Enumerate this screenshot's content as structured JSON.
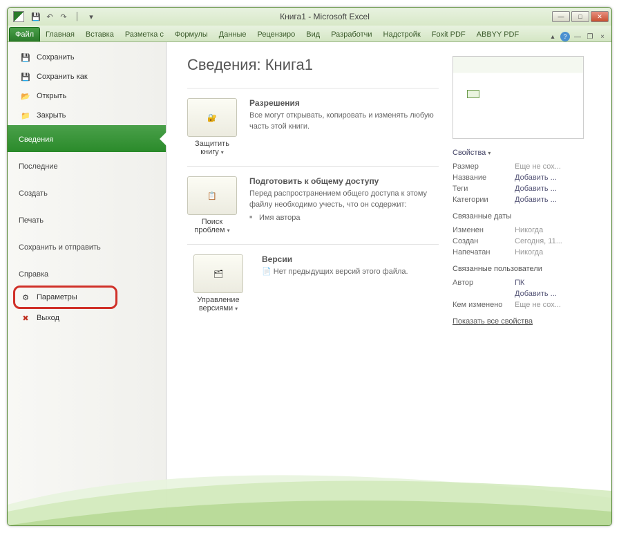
{
  "title": "Книга1  -  Microsoft Excel",
  "qat": {
    "save": "💾",
    "undo": "↶",
    "redo": "↷",
    "sep": "│",
    "more": "▾"
  },
  "win": {
    "min": "—",
    "max": "□",
    "close": "✕"
  },
  "tabs": [
    "Файл",
    "Главная",
    "Вставка",
    "Разметка с",
    "Формулы",
    "Данные",
    "Рецензиро",
    "Вид",
    "Разработчи",
    "Надстройк",
    "Foxit PDF",
    "ABBYY PDF"
  ],
  "ribbon_right": {
    "help": "?",
    "up": "▴",
    "min2": "—",
    "restore": "❐",
    "close2": "×"
  },
  "side": {
    "save": "Сохранить",
    "save_as": "Сохранить как",
    "open": "Открыть",
    "close": "Закрыть",
    "info": "Сведения",
    "recent": "Последние",
    "new": "Создать",
    "print": "Печать",
    "share": "Сохранить и отправить",
    "help": "Справка",
    "options": "Параметры",
    "exit": "Выход"
  },
  "page": {
    "heading": "Сведения: Книга1",
    "perm": {
      "btn": "Защитить книгу",
      "title": "Разрешения",
      "text": "Все могут открывать, копировать и изменять любую часть этой книги."
    },
    "prep": {
      "btn": "Поиск проблем",
      "title": "Подготовить к общему доступу",
      "text": "Перед распространением общего доступа к этому файлу необходимо учесть, что он содержит:",
      "item1": "Имя автора"
    },
    "vers": {
      "btn": "Управление версиями",
      "title": "Версии",
      "text": "Нет предыдущих версий этого файла."
    }
  },
  "props": {
    "title": "Свойства",
    "rows1": [
      {
        "k": "Размер",
        "v": "Еще не сох..."
      },
      {
        "k": "Название",
        "v": "Добавить ..."
      },
      {
        "k": "Теги",
        "v": "Добавить ..."
      },
      {
        "k": "Категории",
        "v": "Добавить ..."
      }
    ],
    "dates_title": "Связанные даты",
    "rows2": [
      {
        "k": "Изменен",
        "v": "Никогда"
      },
      {
        "k": "Создан",
        "v": "Сегодня, 11..."
      },
      {
        "k": "Напечатан",
        "v": "Никогда"
      }
    ],
    "users_title": "Связанные пользователи",
    "rows3": [
      {
        "k": "Автор",
        "v": "ПК"
      },
      {
        "k": "",
        "v": "Добавить ..."
      },
      {
        "k": "Кем изменено",
        "v": "Еще не сох..."
      }
    ],
    "show_all": "Показать все свойства"
  }
}
